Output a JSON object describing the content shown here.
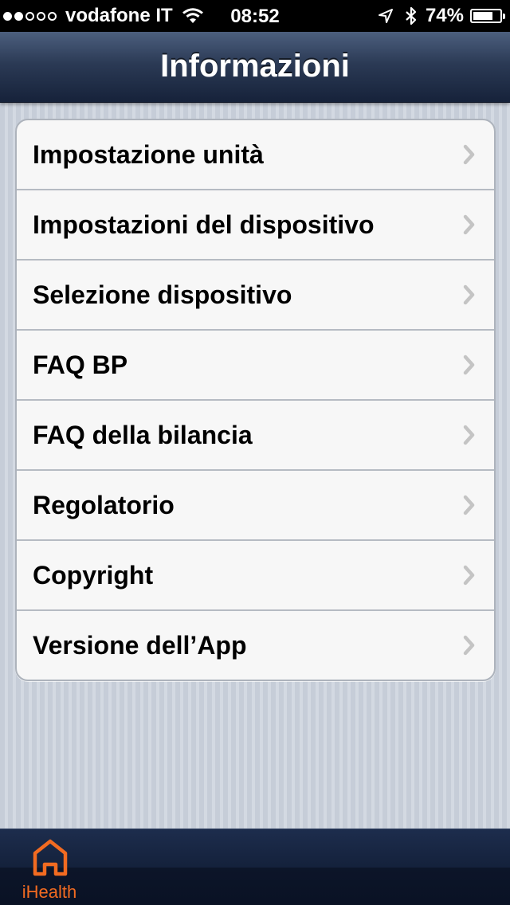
{
  "status_bar": {
    "signal": {
      "bars_filled": 2,
      "bars_total": 5
    },
    "carrier": "vodafone IT",
    "time": "08:52",
    "battery_percent_text": "74%",
    "battery_level": 0.74,
    "icons": [
      "signal-dots-icon",
      "wifi-icon",
      "location-arrow-icon",
      "bluetooth-icon",
      "battery-icon"
    ]
  },
  "navbar": {
    "title": "Informazioni"
  },
  "menu": {
    "items": [
      {
        "label": "Impostazione unità"
      },
      {
        "label": "Impostazioni del dispositivo"
      },
      {
        "label": "Selezione dispositivo"
      },
      {
        "label": "FAQ BP"
      },
      {
        "label": "FAQ della bilancia"
      },
      {
        "label": "Regolatorio"
      },
      {
        "label": "Copyright"
      },
      {
        "label": "Versione dell’App"
      }
    ]
  },
  "tabbar": {
    "tabs": [
      {
        "label": "iHealth",
        "icon": "home-icon",
        "selected": true
      }
    ]
  },
  "colors": {
    "accent": "#f26b21",
    "navbar_dark": "#16223a",
    "background": "#cbd2dc"
  }
}
